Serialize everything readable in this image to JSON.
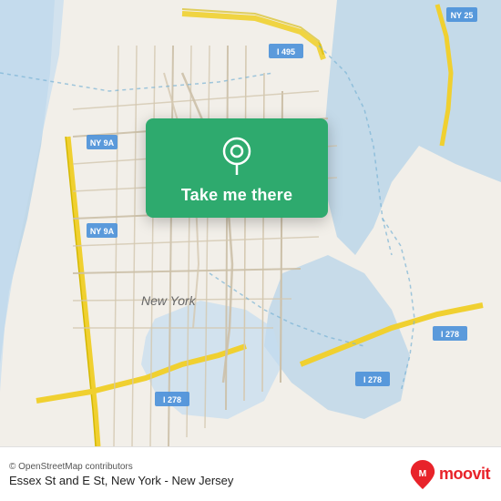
{
  "map": {
    "attribution": "© OpenStreetMap contributors",
    "location_label": "Essex St and E St, New York - New Jersey"
  },
  "card": {
    "button_label": "Take me there"
  },
  "moovit": {
    "text": "moovit"
  }
}
